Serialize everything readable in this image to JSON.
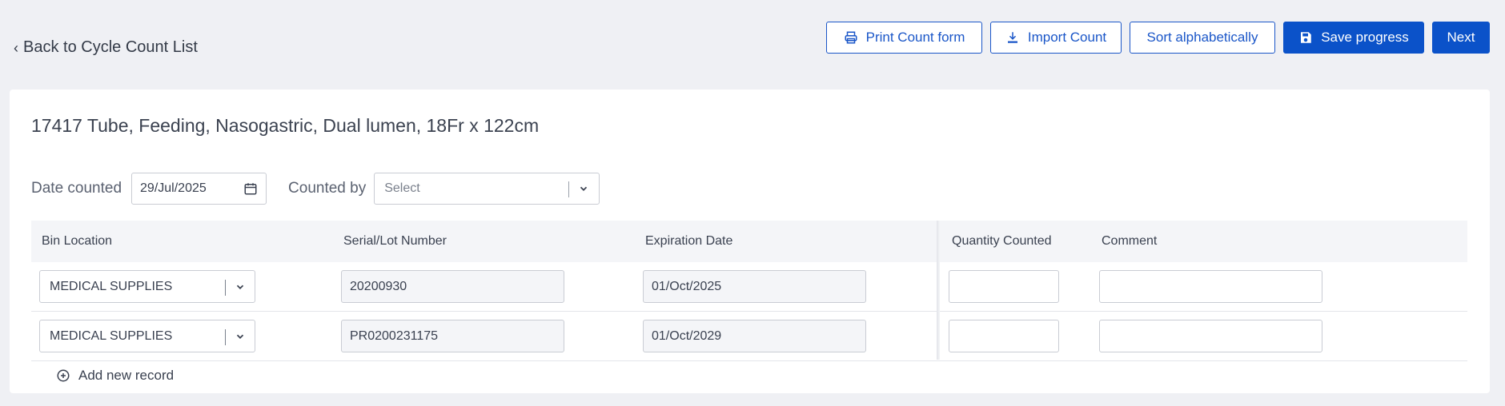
{
  "header": {
    "back_label": "Back to Cycle Count List",
    "print_label": "Print Count form",
    "import_label": "Import Count",
    "sort_label": "Sort alphabetically",
    "save_label": "Save progress",
    "next_label": "Next"
  },
  "product": {
    "title": "17417 Tube, Feeding, Nasogastric, Dual lumen, 18Fr x 122cm"
  },
  "filters": {
    "date_label": "Date counted",
    "date_value": "29/Jul/2025",
    "counted_by_label": "Counted by",
    "counted_by_placeholder": "Select"
  },
  "table": {
    "headers": {
      "bin": "Bin Location",
      "lot": "Serial/Lot Number",
      "exp": "Expiration Date",
      "qty": "Quantity Counted",
      "comment": "Comment"
    },
    "rows": [
      {
        "bin": "MEDICAL SUPPLIES",
        "lot": "20200930",
        "exp": "01/Oct/2025",
        "qty": "",
        "comment": ""
      },
      {
        "bin": "MEDICAL SUPPLIES",
        "lot": "PR0200231175",
        "exp": "01/Oct/2029",
        "qty": "",
        "comment": ""
      }
    ],
    "add_label": "Add new record"
  },
  "colors": {
    "primary": "#0b52c9",
    "background": "#eff0f4"
  }
}
